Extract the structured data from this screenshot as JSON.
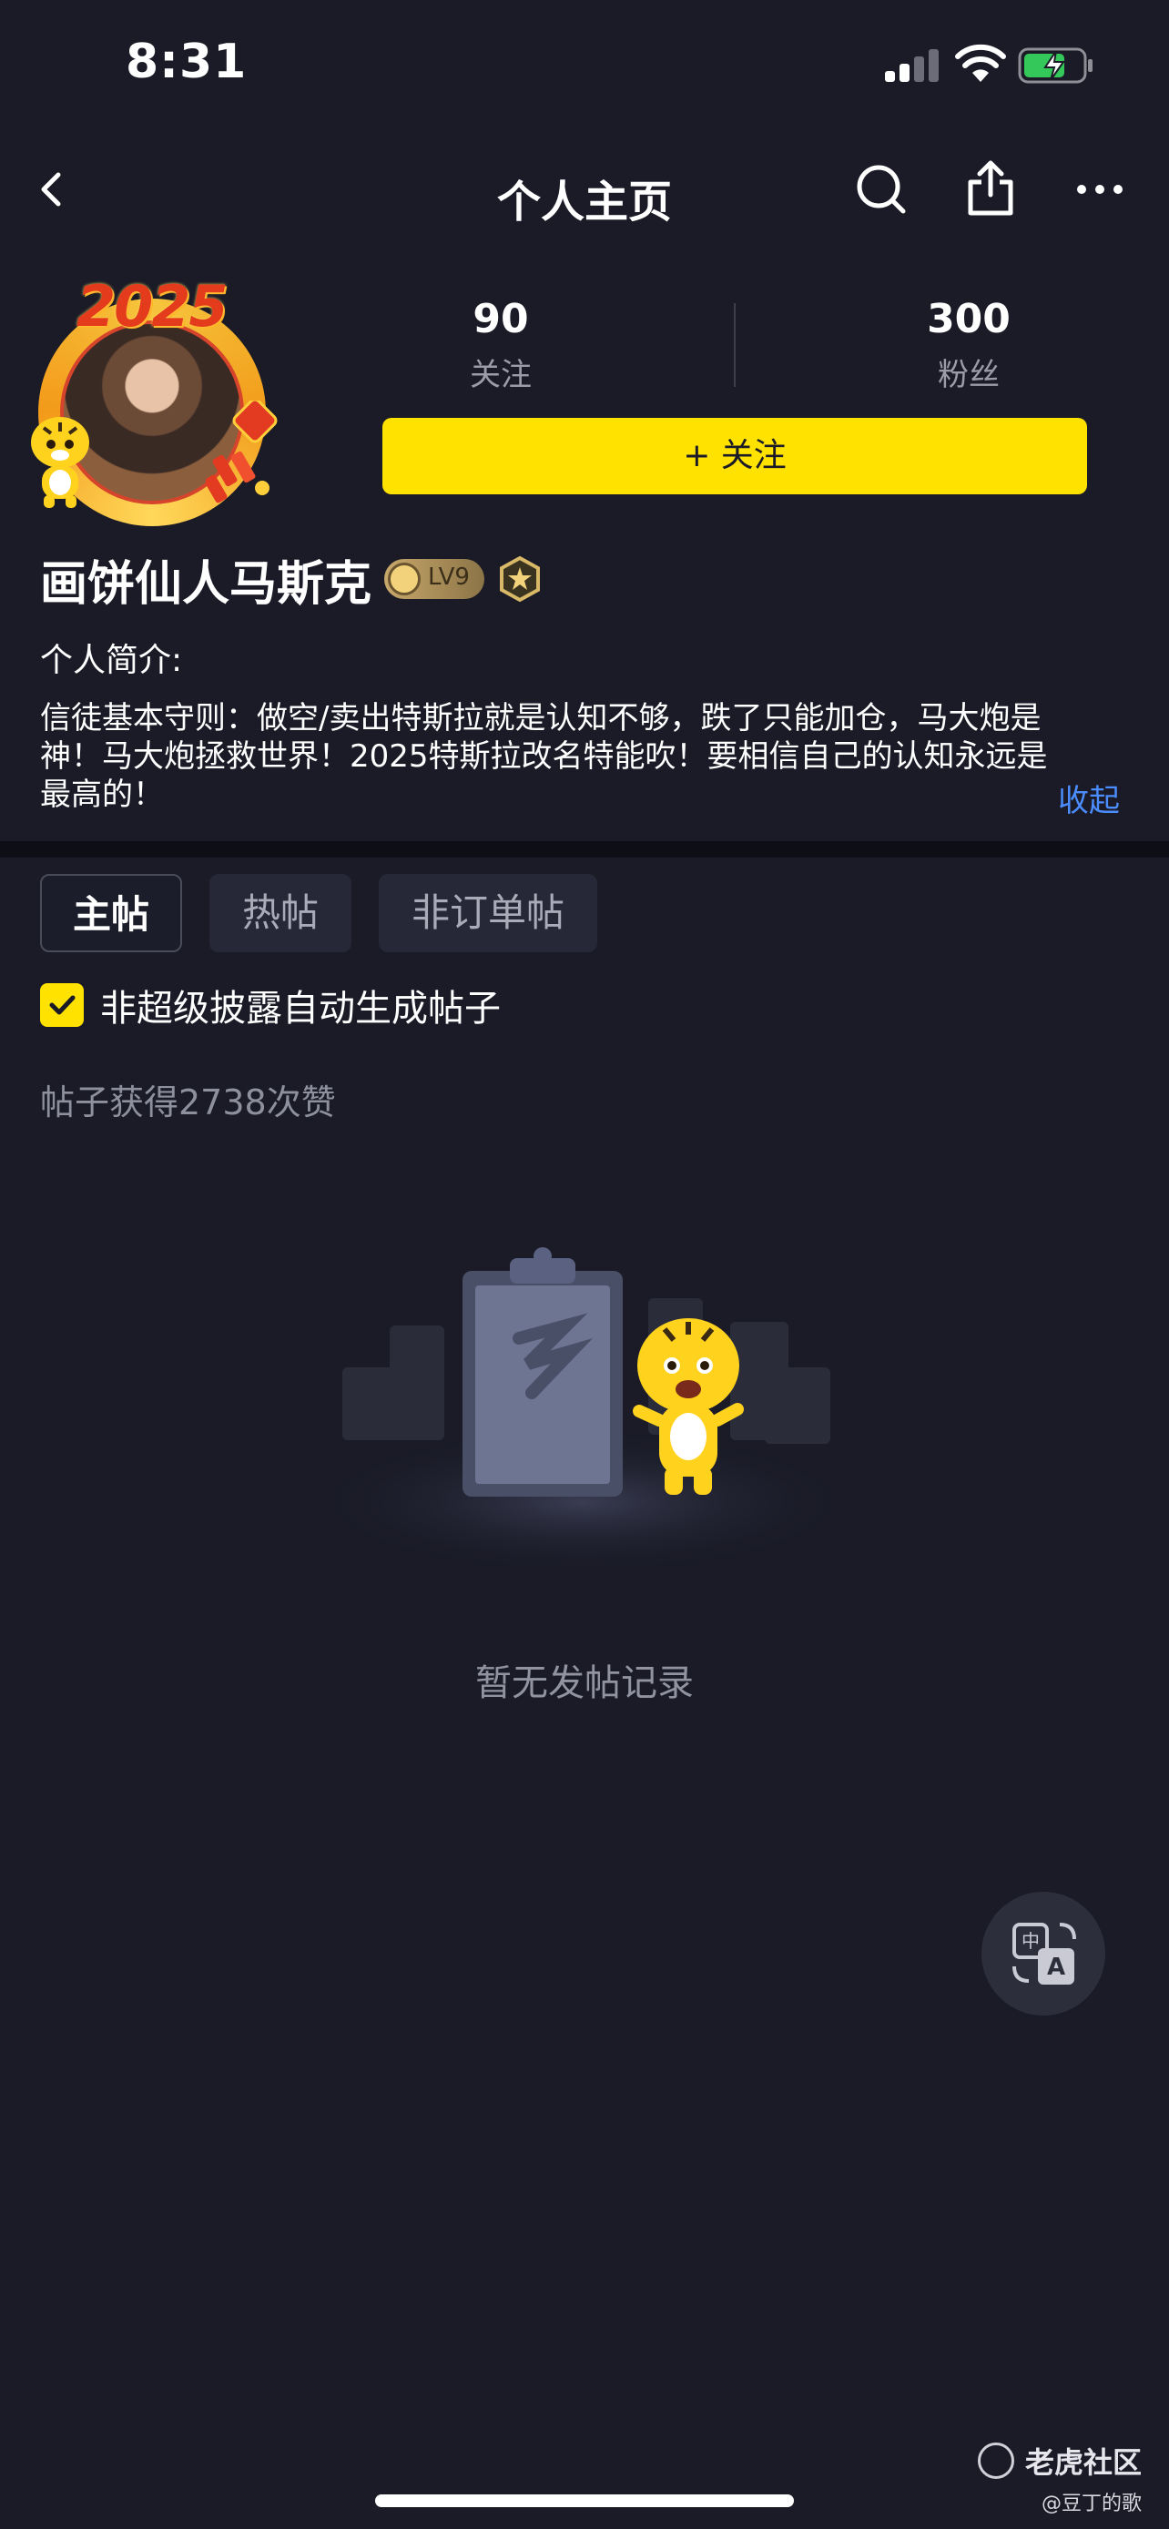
{
  "status_bar": {
    "time": "8:31"
  },
  "nav": {
    "title": "个人主页"
  },
  "profile": {
    "avatar_year": "2025",
    "stats": [
      {
        "value": "90",
        "label": "关注"
      },
      {
        "value": "300",
        "label": "粉丝"
      }
    ],
    "follow_label": "+ 关注",
    "name": "画饼仙人马斯克",
    "level": "LV9",
    "bio_label": "个人简介:",
    "bio_text": "信徒基本守则：做空/卖出特斯拉就是认知不够，跌了只能加仓，马大炮是神！马大炮拯救世界！2025特斯拉改名特能吹！要相信自己的认知永远是最高的！",
    "bio_collapse": "收起"
  },
  "tabs": [
    {
      "label": "主帖",
      "active": true
    },
    {
      "label": "热帖",
      "active": false
    },
    {
      "label": "非订单帖",
      "active": false
    }
  ],
  "filter": {
    "label": "非超级披露自动生成帖子",
    "checked": true
  },
  "likes_text": "帖子获得2738次赞",
  "empty_state": {
    "message": "暂无发帖记录"
  },
  "watermark": {
    "brand": "老虎社区",
    "user": "@豆丁的歌"
  },
  "colors": {
    "accent": "#ffe200",
    "link": "#4b8cff",
    "background": "#1a1b27"
  }
}
